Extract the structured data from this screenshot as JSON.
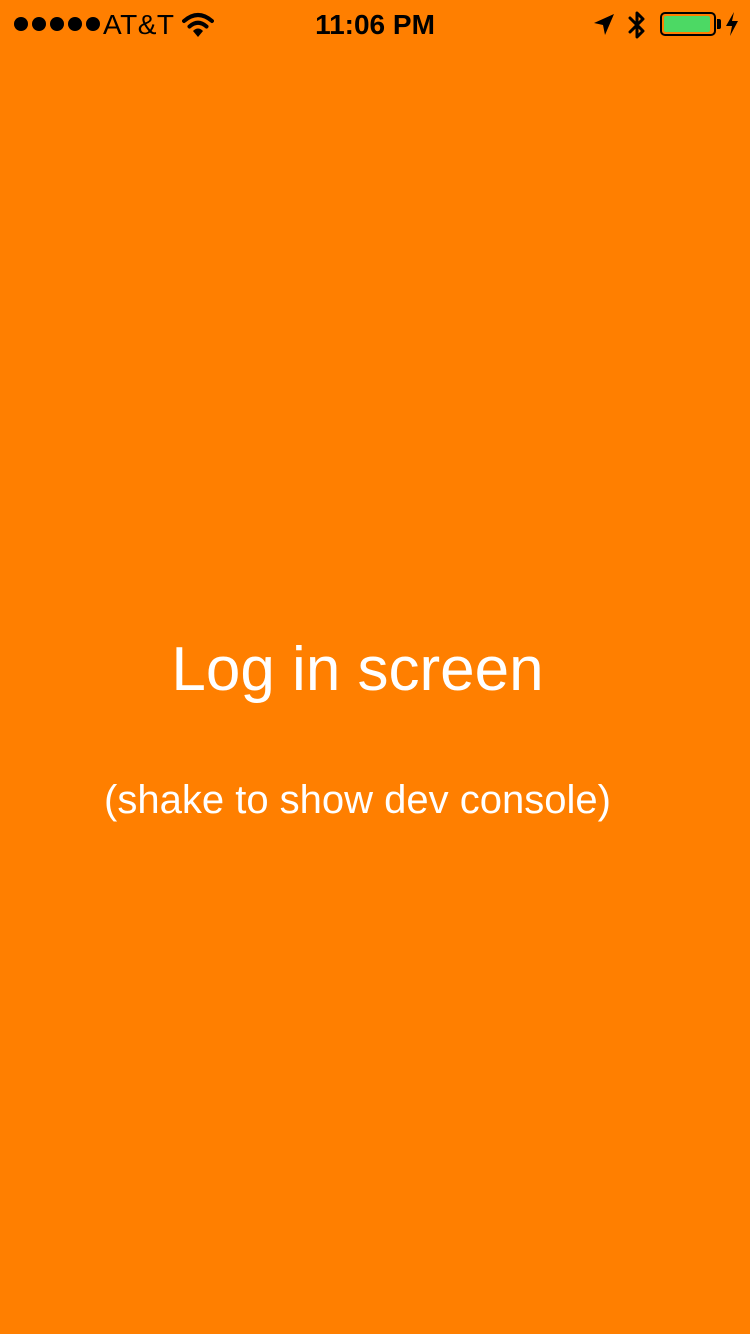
{
  "colors": {
    "background": "#FF7F00",
    "text": "#FFFFFF",
    "status_text": "#000000",
    "battery_fill": "#4CD964"
  },
  "status_bar": {
    "signal_bars": 5,
    "carrier": "AT&T",
    "time": "11:06 PM",
    "icons": [
      "wifi-icon",
      "location-arrow-icon",
      "bluetooth-icon",
      "battery-icon",
      "charging-bolt-icon"
    ],
    "battery_level": 0.95
  },
  "main": {
    "title": "Log in screen",
    "subtitle": "(shake to show dev console)"
  }
}
